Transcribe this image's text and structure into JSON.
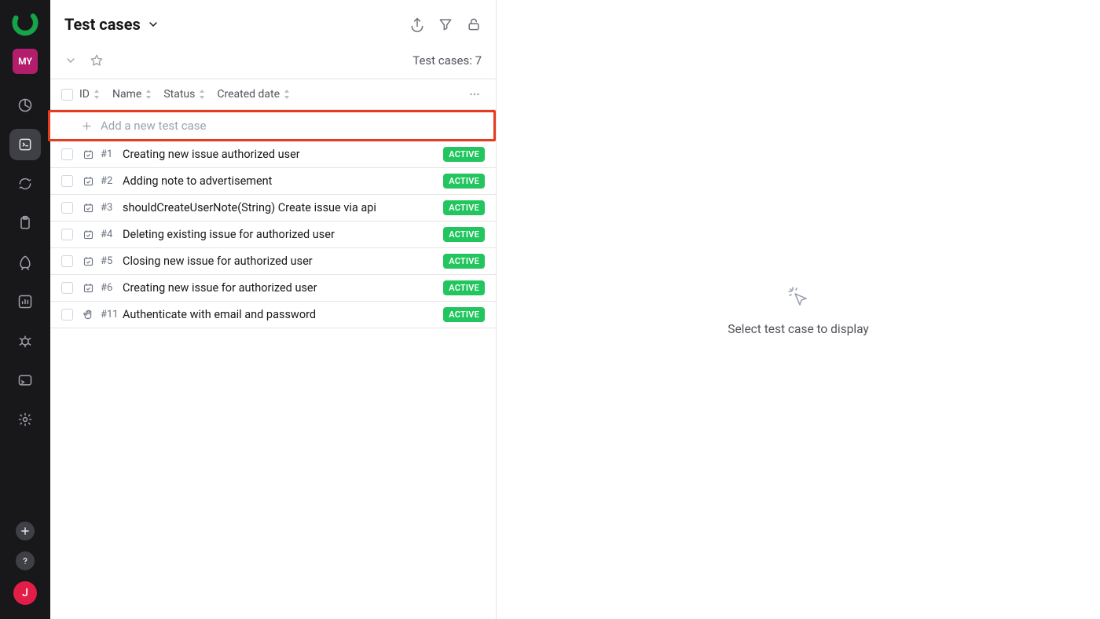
{
  "sidebar": {
    "project_badge": "MY",
    "user_initial": "J"
  },
  "header": {
    "title": "Test cases"
  },
  "subheader": {
    "count_label": "Test cases: 7"
  },
  "columns": {
    "id": "ID",
    "name": "Name",
    "status": "Status",
    "created": "Created date"
  },
  "add_row": {
    "label": "Add a new test case"
  },
  "rows": [
    {
      "id": "#1",
      "name": "Creating new issue authorized user",
      "status": "ACTIVE",
      "type": "auto"
    },
    {
      "id": "#2",
      "name": "Adding note to advertisement",
      "status": "ACTIVE",
      "type": "auto"
    },
    {
      "id": "#3",
      "name": "shouldCreateUserNote(String) Create issue via api",
      "status": "ACTIVE",
      "type": "auto"
    },
    {
      "id": "#4",
      "name": "Deleting existing issue for authorized user",
      "status": "ACTIVE",
      "type": "auto"
    },
    {
      "id": "#5",
      "name": "Closing new issue for authorized user",
      "status": "ACTIVE",
      "type": "auto"
    },
    {
      "id": "#6",
      "name": "Creating new issue for authorized user",
      "status": "ACTIVE",
      "type": "auto"
    },
    {
      "id": "#11",
      "name": "Authenticate with email and password",
      "status": "ACTIVE",
      "type": "manual"
    }
  ],
  "detail": {
    "empty_text": "Select test case to display"
  }
}
